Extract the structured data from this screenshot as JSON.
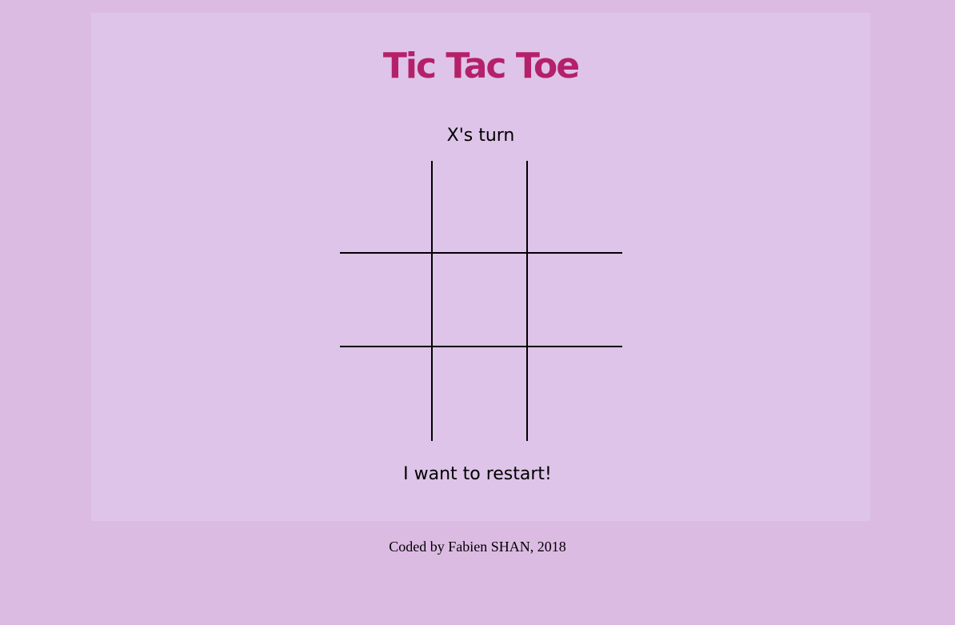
{
  "game": {
    "title": "Tic Tac Toe",
    "turn_text": "X's turn",
    "board": [
      "",
      "",
      "",
      "",
      "",
      "",
      "",
      "",
      ""
    ],
    "restart_label": "I want to restart!"
  },
  "footer": {
    "credit": "Coded by Fabien SHAN, 2018"
  },
  "colors": {
    "page_background": "#dcbbe3",
    "panel_background": "#dec4e8",
    "title_color": "#b5206a",
    "grid_line": "#000000"
  }
}
